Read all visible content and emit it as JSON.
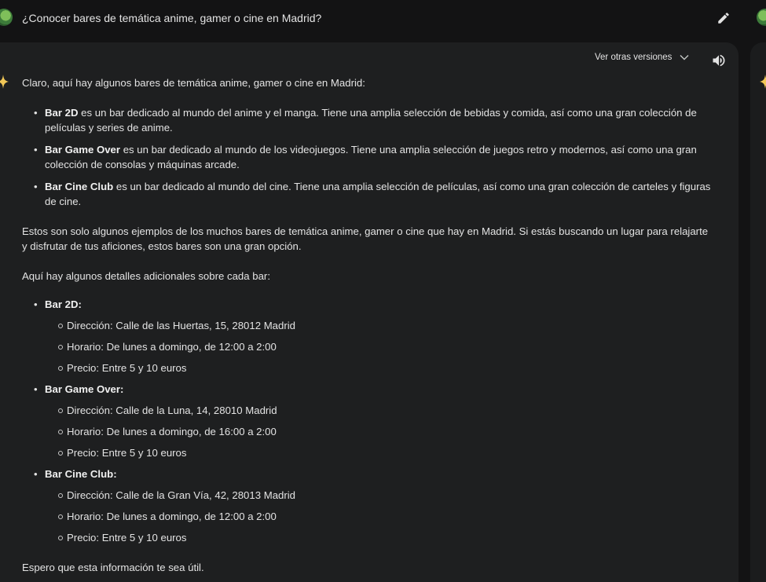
{
  "prompt": {
    "text": "¿Conocer bares de temática anime, gamer o cine en Madrid?"
  },
  "toolbar": {
    "versions_label": "Ver otras versiones"
  },
  "icons": {
    "edit": "pencil-icon",
    "chevron": "chevron-down-icon",
    "speaker": "speaker-icon",
    "spark": "gemini-spark-icon"
  },
  "response": {
    "intro": "Claro, aquí hay algunos bares de temática anime, gamer o cine en Madrid:",
    "bars": [
      {
        "name": "Bar 2D",
        "desc": " es un bar dedicado al mundo del anime y el manga. Tiene una amplia selección de bebidas y comida, así como una gran colección de películas y series de anime."
      },
      {
        "name": "Bar Game Over",
        "desc": " es un bar dedicado al mundo de los videojuegos. Tiene una amplia selección de juegos retro y modernos, así como una gran colección de consolas y máquinas arcade."
      },
      {
        "name": "Bar Cine Club",
        "desc": " es un bar dedicado al mundo del cine. Tiene una amplia selección de películas, así como una gran colección de carteles y figuras de cine."
      }
    ],
    "summary": "Estos son solo algunos ejemplos de los muchos bares de temática anime, gamer o cine que hay en Madrid. Si estás buscando un lugar para relajarte y disfrutar de tus aficiones, estos bares son una gran opción.",
    "details_intro": "Aquí hay algunos detalles adicionales sobre cada bar:",
    "details": [
      {
        "name": "Bar 2D:",
        "items": [
          "Dirección: Calle de las Huertas, 15, 28012 Madrid",
          "Horario: De lunes a domingo, de 12:00 a 2:00",
          "Precio: Entre 5 y 10 euros"
        ]
      },
      {
        "name": "Bar Game Over:",
        "items": [
          "Dirección: Calle de la Luna, 14, 28010 Madrid",
          "Horario: De lunes a domingo, de 16:00 a 2:00",
          "Precio: Entre 5 y 10 euros"
        ]
      },
      {
        "name": "Bar Cine Club:",
        "items": [
          "Dirección: Calle de la Gran Vía, 42, 28013 Madrid",
          "Horario: De lunes a domingo, de 12:00 a 2:00",
          "Precio: Entre 5 y 10 euros"
        ]
      }
    ],
    "closing": "Espero que esta información te sea útil."
  }
}
